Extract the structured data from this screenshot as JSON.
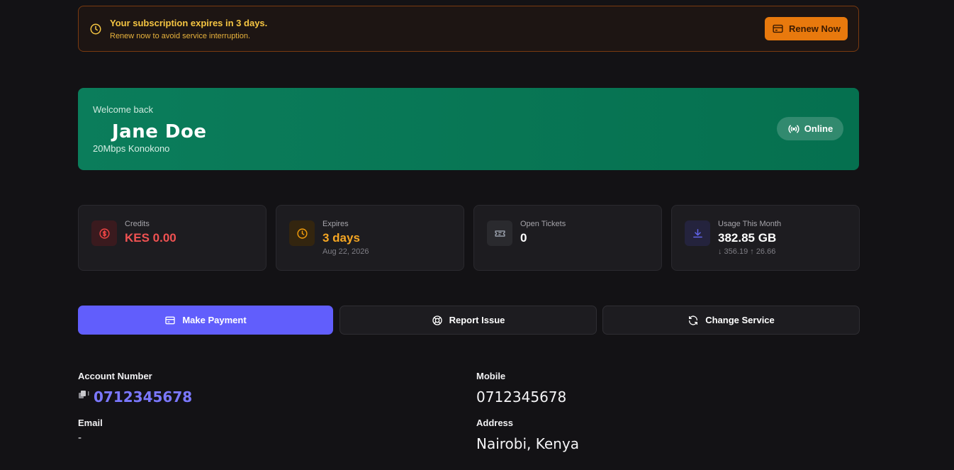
{
  "alert": {
    "title": "Your subscription expires in 3 days.",
    "subtitle": "Renew now to avoid service interruption.",
    "button_label": "Renew Now"
  },
  "welcome": {
    "label": "Welcome back",
    "name": "Jane Doe",
    "plan": "20Mbps Konokono",
    "status": "Online"
  },
  "stats": [
    {
      "label": "Credits",
      "value": "KES 0.00",
      "sub": "",
      "icon": "dollar-circle-icon",
      "color": "#ef4444"
    },
    {
      "label": "Expires",
      "value": "3 days",
      "sub": "Aug 22, 2026",
      "icon": "clock-icon",
      "color": "#f59e0b"
    },
    {
      "label": "Open Tickets",
      "value": "0",
      "sub": "",
      "icon": "ticket-icon",
      "color": "#9ca3af"
    },
    {
      "label": "Usage This Month",
      "value": "382.85 GB",
      "sub": "↓ 356.19 ↑ 26.66",
      "icon": "download-icon",
      "color": "#6366f1"
    }
  ],
  "actions": {
    "payment": "Make Payment",
    "report": "Report Issue",
    "change": "Change Service"
  },
  "details": {
    "account_label": "Account Number",
    "account_value": "0712345678",
    "mobile_label": "Mobile",
    "mobile_value": "0712345678",
    "email_label": "Email",
    "email_value": "-",
    "address_label": "Address",
    "address_value": "Nairobi, Kenya"
  },
  "colors": {
    "accent": "#615efc",
    "warning": "#e8790d",
    "success": "#0b7d5b",
    "danger": "#ef4444"
  }
}
